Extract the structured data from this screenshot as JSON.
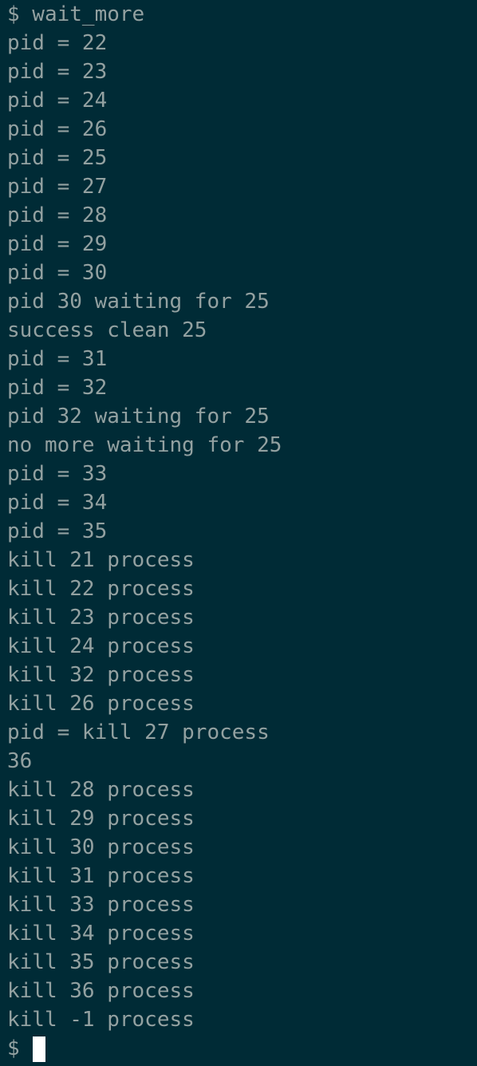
{
  "terminal": {
    "lines": [
      "$ wait_more",
      "pid = 22",
      "pid = 23",
      "pid = 24",
      "pid = 26",
      "pid = 25",
      "pid = 27",
      "pid = 28",
      "pid = 29",
      "pid = 30",
      "pid 30 waiting for 25",
      "success clean 25",
      "pid = 31",
      "pid = 32",
      "pid 32 waiting for 25",
      "no more waiting for 25",
      "pid = 33",
      "pid = 34",
      "pid = 35",
      "kill 21 process",
      "kill 22 process",
      "kill 23 process",
      "kill 24 process",
      "kill 32 process",
      "kill 26 process",
      "pid = kill 27 process",
      "36",
      "kill 28 process",
      "kill 29 process",
      "kill 30 process",
      "kill 31 process",
      "kill 33 process",
      "kill 34 process",
      "kill 35 process",
      "kill 36 process",
      "kill -1 process"
    ],
    "prompt": "$",
    "colors": {
      "background": "#002b36",
      "foreground": "#93a1a1",
      "cursor": "#ffffff"
    }
  }
}
